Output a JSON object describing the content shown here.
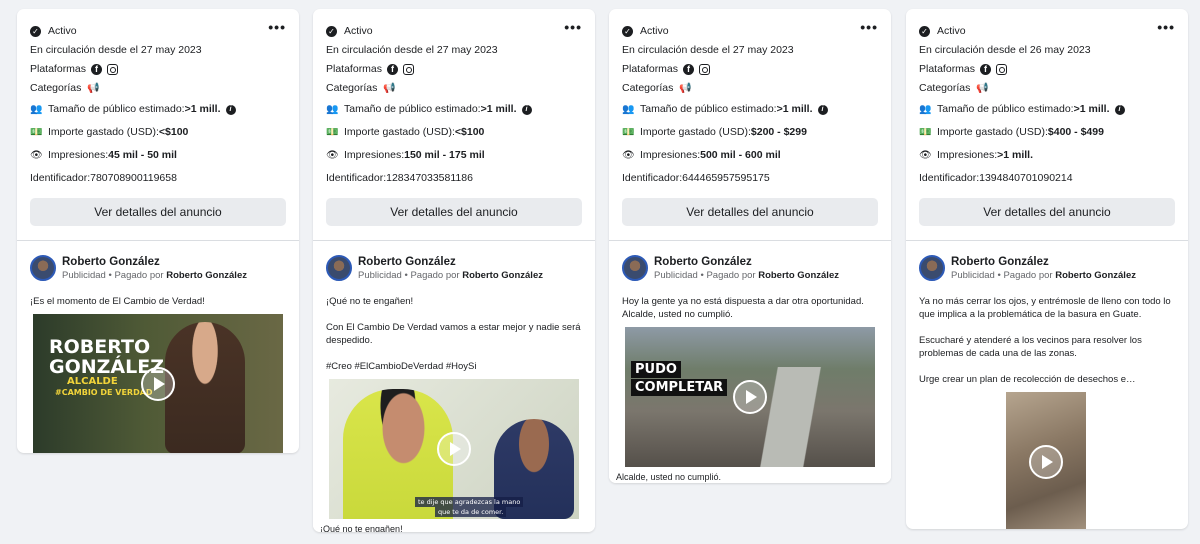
{
  "common": {
    "status": "Activo",
    "platforms_label": "Plataformas",
    "categories_label": "Categorías",
    "audience_label": "Tamaño de público estimado:",
    "spend_label": "Importe gastado (USD): ",
    "impressions_label": "Impresiones: ",
    "id_label": "Identificador: ",
    "details_button": "Ver detalles del anuncio",
    "advertiser": "Roberto González",
    "sponsored": "Publicidad",
    "paid_by": " • Pagado por ",
    "more": "•••"
  },
  "cards": [
    {
      "running_since": "En circulación desde el 27 may 2023",
      "audience": ">1 mill.",
      "spend": "<$100",
      "impressions": "45 mil - 50 mil",
      "id": "780708900119658",
      "text": "¡Es el momento de El Cambio de Verdad!",
      "overlay": [
        "ROBERTO",
        "GONZÁLEZ",
        "ALCALDE",
        "#CAMBIO DE VERDAD"
      ],
      "caption": ""
    },
    {
      "running_since": "En circulación desde el 27 may 2023",
      "audience": ">1 mill.",
      "spend": "<$100",
      "impressions": "150 mil - 175 mil",
      "id": "128347033581186",
      "text": "¡Qué no te engañen!\n\nCon El Cambio De Verdad vamos a estar mejor y nadie será despedido.\n\n#Creo #ElCambioDeVerdad #HoySi",
      "overlay": [
        "te dije que agradezcas la mano",
        "que  te da de comer."
      ],
      "caption": "¡Qué no te engañen!"
    },
    {
      "running_since": "En circulación desde el 27 may 2023",
      "audience": ">1 mill.",
      "spend": "$200 - $299",
      "impressions": "500 mil - 600 mil",
      "id": "644465957595175",
      "text": "Hoy la gente ya no está dispuesta a dar otra oportunidad. Alcalde, usted no cumplió.",
      "overlay": [
        "PUDO",
        "COMPLETAR"
      ],
      "caption": "Alcalde, usted no cumplió."
    },
    {
      "running_since": "En circulación desde el 26 may 2023",
      "audience": ">1 mill.",
      "spend": "$400 - $499",
      "impressions": ">1 mill.",
      "id": "1394840701090214",
      "text": "Ya no más cerrar los ojos, y entrémosle de lleno con todo lo que implica a la problemática de la basura en Guate.\n\nEscucharé y atenderé a los vecinos para resolver los problemas de cada una de las zonas.\n\nUrge crear un plan de recolección de desechos e…",
      "overlay": [],
      "caption": ""
    }
  ]
}
